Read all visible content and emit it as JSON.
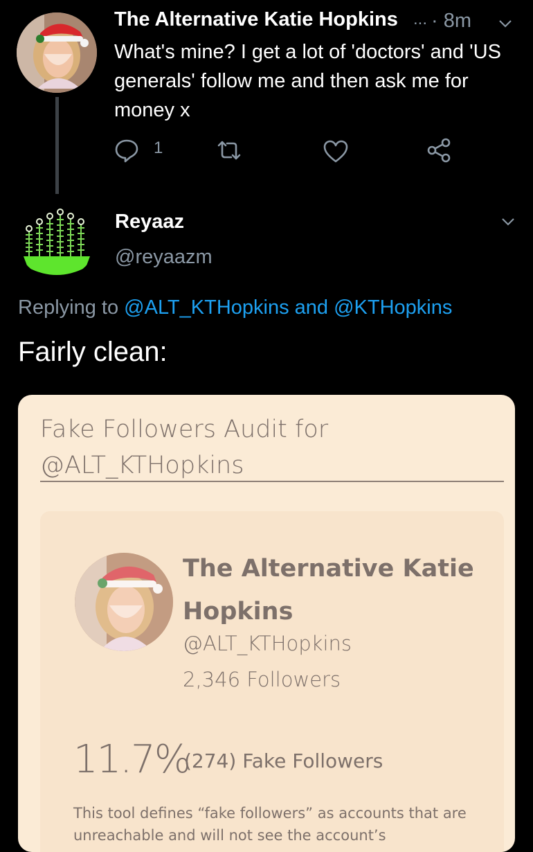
{
  "parent_tweet": {
    "author_name": "The Alternative Katie Hopkins",
    "truncation": "...",
    "time": "· 8m",
    "text": "What's mine? I get a lot of 'doctors' and 'US generals' follow me and then ask me for money x",
    "reply_count": "1"
  },
  "reply_tweet": {
    "author_name": "Reyaaz",
    "handle": "@reyaazm",
    "replying_prefix": "Replying to",
    "mention_1": "@ALT_KTHopkins",
    "conjunction": "and",
    "mention_2": "@KTHopkins",
    "text": "Fairly clean:"
  },
  "audit_card": {
    "title": "Fake Followers Audit for @ALT_KTHopkins",
    "profile_name": "The Alternative Katie Hopkins",
    "profile_handle": "@ALT_KTHopkins",
    "followers": "2,346 Followers",
    "fake_percent": "11.7%",
    "fake_count_label": "(274) Fake Followers",
    "description": "This tool defines “fake followers” as accounts that are unreachable and will not see the account’s"
  },
  "icons": {
    "chevron": "chevron-down-icon",
    "reply": "reply-icon",
    "retweet": "retweet-icon",
    "like": "heart-icon",
    "share": "share-icon"
  },
  "colors": {
    "background": "#000000",
    "secondary_text": "#8b98a5",
    "mention": "#1da1f2",
    "card_bg": "#fbebd6",
    "card_text": "#7d706a"
  }
}
